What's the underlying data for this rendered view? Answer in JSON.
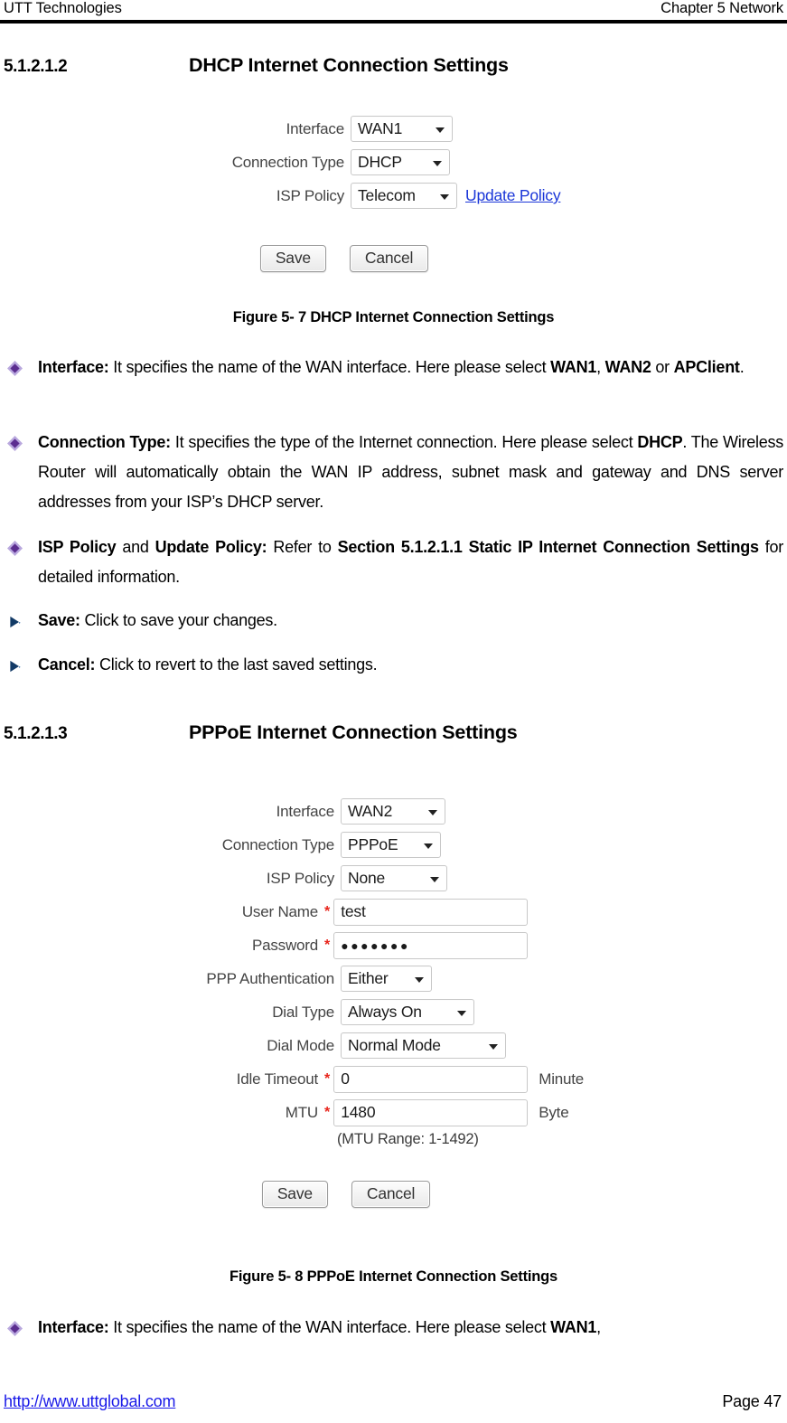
{
  "header": {
    "left": "UTT Technologies",
    "right": "Chapter 5 Network"
  },
  "sections": [
    {
      "number": "5.1.2.1.2",
      "title": "DHCP Internet Connection Settings"
    },
    {
      "number": "5.1.2.1.3",
      "title": "PPPoE Internet Connection Settings"
    }
  ],
  "dhcp_form": {
    "rows": [
      {
        "label": "Interface",
        "control": "select",
        "value": "WAN1"
      },
      {
        "label": "Connection Type",
        "control": "select",
        "value": "DHCP"
      },
      {
        "label": "ISP Policy",
        "control": "select",
        "value": "Telecom",
        "link": "Update Policy"
      }
    ],
    "buttons": {
      "save": "Save",
      "cancel": "Cancel"
    }
  },
  "pppoe_form": {
    "rows": [
      {
        "label": "Interface",
        "control": "select",
        "value": "WAN2"
      },
      {
        "label": "Connection Type",
        "control": "select",
        "value": "PPPoE"
      },
      {
        "label": "ISP Policy",
        "control": "select",
        "value": "None"
      },
      {
        "label": "User Name",
        "control": "text",
        "value": "test",
        "required": "*"
      },
      {
        "label": "Password",
        "control": "password",
        "value": "●●●●●●●",
        "required": "*"
      },
      {
        "label": "PPP Authentication",
        "control": "select",
        "value": "Either"
      },
      {
        "label": "Dial Type",
        "control": "select",
        "value": "Always On"
      },
      {
        "label": "Dial Mode",
        "control": "select",
        "value": "Normal Mode"
      },
      {
        "label": "Idle Timeout",
        "control": "text",
        "value": "0",
        "required": "*",
        "unit": "Minute"
      },
      {
        "label": "MTU",
        "control": "text",
        "value": "1480",
        "required": "*",
        "unit": "Byte"
      }
    ],
    "note": "(MTU Range: 1-1492)",
    "buttons": {
      "save": "Save",
      "cancel": "Cancel"
    }
  },
  "captions": {
    "figure_5_7": "Figure 5- 7 DHCP Internet Connection Settings",
    "figure_5_8": "Figure 5- 8 PPPoE Internet Connection Settings"
  },
  "body": {
    "interface_dhcp": {
      "b1": "Interface:",
      "t1": " It specifies the name of the WAN interface. Here please select ",
      "b2": "WAN1",
      "t2": ", ",
      "b3": "WAN2",
      "t3": " or ",
      "b4": "APClient",
      "t4": "."
    },
    "connection_type": {
      "b1": "Connection Type:",
      "t1": " It specifies the type of the Internet connection. Here please select ",
      "b2": "DHCP",
      "t2": ". The Wireless Router will automatically obtain the WAN IP address, subnet mask and gateway and DNS server addresses from your ISP’s DHCP server."
    },
    "isp_policy": {
      "b1": "ISP Policy",
      "t1": " and ",
      "b2": "Update Policy:",
      "t2": " Refer to ",
      "b3": "Section 5.1.2.1.1 Static IP Internet Connection Settings",
      "t3": " for detailed information."
    },
    "save": {
      "b1": "Save:",
      "t1": " Click to save your changes."
    },
    "cancel": {
      "b1": "Cancel:",
      "t1": " Click to revert to the last saved settings."
    },
    "interface_pppoe": {
      "b1": "Interface:",
      "t1": " It specifies the name of the WAN interface. Here please select ",
      "b2": "WAN1",
      "t2": ","
    }
  },
  "footer": {
    "url": "http://www.uttglobal.com",
    "page": "Page 47"
  },
  "colors": {
    "bullet_diamond": "#5b2d90",
    "bullet_arrow": "#123a66",
    "required_star": "#e8241b",
    "link": "#1a36d8",
    "footer_link": "#1a1ae8"
  }
}
